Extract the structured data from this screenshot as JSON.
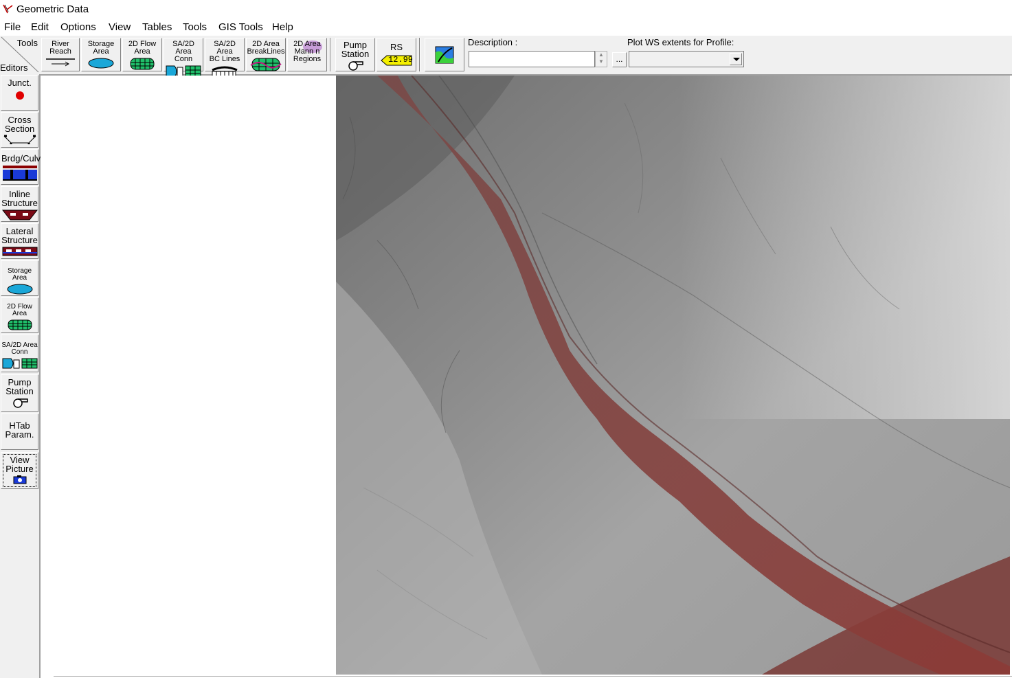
{
  "window": {
    "title": "Geometric Data",
    "icon": "hec-ras-icon"
  },
  "menu": [
    "File",
    "Edit",
    "Options",
    "View",
    "Tables",
    "Tools",
    "GIS Tools",
    "Help"
  ],
  "toolbar": {
    "corner_tools": "Tools",
    "corner_editors": "Editors",
    "buttons": [
      {
        "label": "River\nReach",
        "icon": "river-reach-icon"
      },
      {
        "label": "Storage\nArea",
        "icon": "storage-area-icon"
      },
      {
        "label": "2D Flow\nArea",
        "icon": "2d-flow-area-icon"
      },
      {
        "label": "SA/2D Area\nConn",
        "icon": "sa-2d-conn-icon"
      },
      {
        "label": "SA/2D Area\nBC Lines",
        "icon": "bc-lines-icon"
      },
      {
        "label": "2D Area\nBreakLines",
        "icon": "breaklines-icon"
      },
      {
        "label": "2D Area\nMann n\nRegions",
        "icon": "mann-n-regions-icon"
      },
      {
        "label": "Pump\nStation",
        "icon": "pump-station-icon"
      },
      {
        "label": "RS",
        "icon": "rs-icon",
        "rs_value": "12.99"
      },
      {
        "label": "",
        "icon": "map-layers-icon"
      }
    ],
    "description_label": "Description :",
    "description_value": "",
    "ellipsis": "...",
    "plot_ws_label": "Plot WS extents for Profile:",
    "plot_ws_value": ""
  },
  "editors": [
    {
      "label": "Junct.",
      "icon": "junction-icon"
    },
    {
      "label": "Cross\nSection",
      "icon": "cross-section-icon"
    },
    {
      "label": "Brdg/Culv",
      "icon": "bridge-culvert-icon"
    },
    {
      "label": "Inline\nStructure",
      "icon": "inline-structure-icon"
    },
    {
      "label": "Lateral\nStructure",
      "icon": "lateral-structure-icon"
    },
    {
      "label": "Storage\nArea",
      "icon": "storage-area-icon"
    },
    {
      "label": "2D Flow\nArea",
      "icon": "2d-flow-area-icon"
    },
    {
      "label": "SA/2D Area\nConn",
      "icon": "sa-2d-conn-icon"
    },
    {
      "label": "Pump\nStation",
      "icon": "pump-station-icon"
    },
    {
      "label": "HTab\nParam.",
      "icon": ""
    },
    {
      "label": "View\nPicture",
      "icon": "camera-icon"
    }
  ],
  "colors": {
    "accent_red": "#e00000",
    "storage_cyan": "#1aa7d8",
    "flow_green": "#1fbf6a",
    "terrain_gray": "#8a8a8a",
    "channel_red": "#8a3a36"
  }
}
